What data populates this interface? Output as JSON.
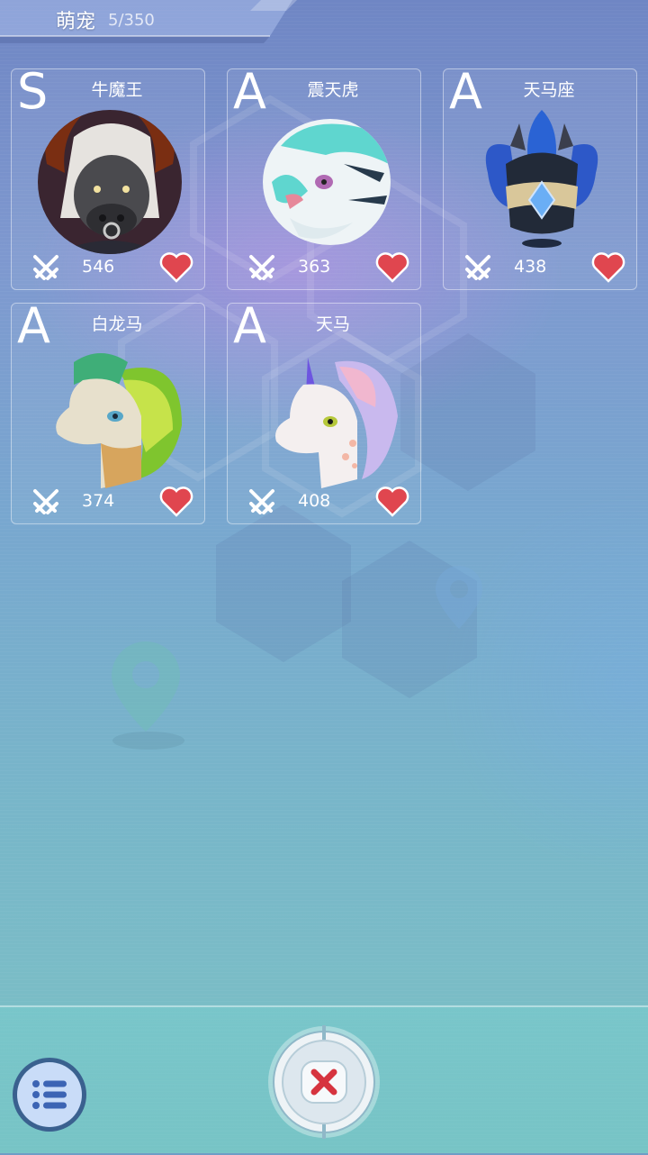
{
  "header": {
    "title": "萌宠",
    "count": "5/350"
  },
  "pets": [
    {
      "grade": "S",
      "name": "牛魔王",
      "power": "546",
      "portrait": "bull-demon-king-portrait"
    },
    {
      "grade": "A",
      "name": "震天虎",
      "power": "363",
      "portrait": "white-tiger-portrait"
    },
    {
      "grade": "A",
      "name": "天马座",
      "power": "438",
      "portrait": "pegasus-helmet-portrait"
    },
    {
      "grade": "A",
      "name": "白龙马",
      "power": "374",
      "portrait": "white-dragon-horse-portrait"
    },
    {
      "grade": "A",
      "name": "天马",
      "power": "408",
      "portrait": "unicorn-portrait"
    }
  ],
  "icons": {
    "power": "crossed-swords-icon",
    "favorite": "heart-icon",
    "menu": "list-menu-icon",
    "close": "close-x-icon"
  },
  "colors": {
    "heart": "#e0464f",
    "close_x": "#d6343f",
    "menu_circle": "#c9dcf8"
  }
}
